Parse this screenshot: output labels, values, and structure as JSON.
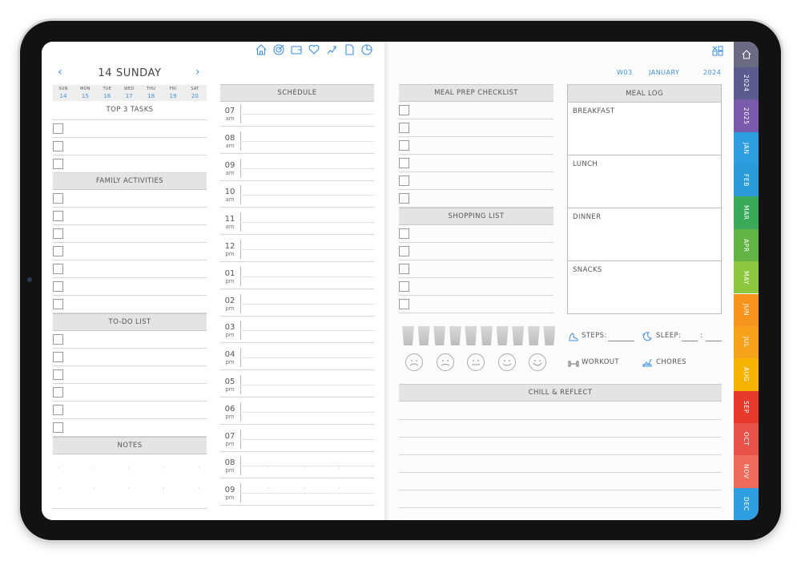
{
  "nav_icons": [
    "home-icon",
    "target-icon",
    "wallet-icon",
    "heart-icon",
    "fitness-icon",
    "note-icon",
    "pie-chart-icon"
  ],
  "day_header": {
    "prev": "‹",
    "title": "14 SUNDAY",
    "next": "›"
  },
  "week_days": [
    {
      "label": "SUN",
      "num": "14"
    },
    {
      "label": "MON",
      "num": "15"
    },
    {
      "label": "TUE",
      "num": "16"
    },
    {
      "label": "WED",
      "num": "17"
    },
    {
      "label": "THU",
      "num": "18"
    },
    {
      "label": "FRI",
      "num": "19"
    },
    {
      "label": "SAT",
      "num": "20"
    }
  ],
  "sections": {
    "top_tasks": "TOP 3 TASKS",
    "family": "FAMILY ACTIVITIES",
    "todo": "TO-DO LIST",
    "notes": "NOTES",
    "schedule": "SCHEDULE",
    "meal_prep": "MEAL PREP CHECKLIST",
    "shopping": "SHOPPING LIST",
    "meal_log": "MEAL LOG",
    "chill": "CHILL & REFLECT"
  },
  "hours": [
    {
      "h": "07",
      "p": "am"
    },
    {
      "h": "08",
      "p": "am"
    },
    {
      "h": "09",
      "p": "am"
    },
    {
      "h": "10",
      "p": "am"
    },
    {
      "h": "11",
      "p": "am"
    },
    {
      "h": "12",
      "p": "pm"
    },
    {
      "h": "01",
      "p": "pm"
    },
    {
      "h": "02",
      "p": "pm"
    },
    {
      "h": "03",
      "p": "pm"
    },
    {
      "h": "04",
      "p": "pm"
    },
    {
      "h": "05",
      "p": "pm"
    },
    {
      "h": "06",
      "p": "pm"
    },
    {
      "h": "07",
      "p": "pm"
    },
    {
      "h": "08",
      "p": "pm"
    },
    {
      "h": "09",
      "p": "pm"
    }
  ],
  "top_right": {
    "week": "W03",
    "month": "JANUARY",
    "year": "2024"
  },
  "meals": [
    "BREAKFAST",
    "LUNCH",
    "DINNER",
    "SNACKS"
  ],
  "trackers": {
    "steps": "STEPS:",
    "sleep": "SLEEP:",
    "sleep_sep": ":",
    "workout": "WORKOUT",
    "chores": "CHORES"
  },
  "side_tabs": [
    {
      "label": "2024",
      "color": "#5b5b8f"
    },
    {
      "label": "2025",
      "color": "#7a5bab"
    },
    {
      "label": "JAN",
      "color": "#2f9ee0"
    },
    {
      "label": "FEB",
      "color": "#2a9bd8"
    },
    {
      "label": "MAR",
      "color": "#3aaa5a"
    },
    {
      "label": "APR",
      "color": "#63b446"
    },
    {
      "label": "MAY",
      "color": "#8dc63f"
    },
    {
      "label": "JUN",
      "color": "#f7941d"
    },
    {
      "label": "JUL",
      "color": "#f6a21a"
    },
    {
      "label": "AUG",
      "color": "#f4b400"
    },
    {
      "label": "SEP",
      "color": "#e63a2e"
    },
    {
      "label": "OCT",
      "color": "#e8524a"
    },
    {
      "label": "NOV",
      "color": "#ee6a5a"
    },
    {
      "label": "DEC",
      "color": "#2f9ee0"
    }
  ],
  "water_glasses": 10,
  "mood_faces": [
    "very-sad-face-icon",
    "sad-face-icon",
    "neutral-face-icon",
    "happy-face-icon",
    "very-happy-face-icon"
  ]
}
